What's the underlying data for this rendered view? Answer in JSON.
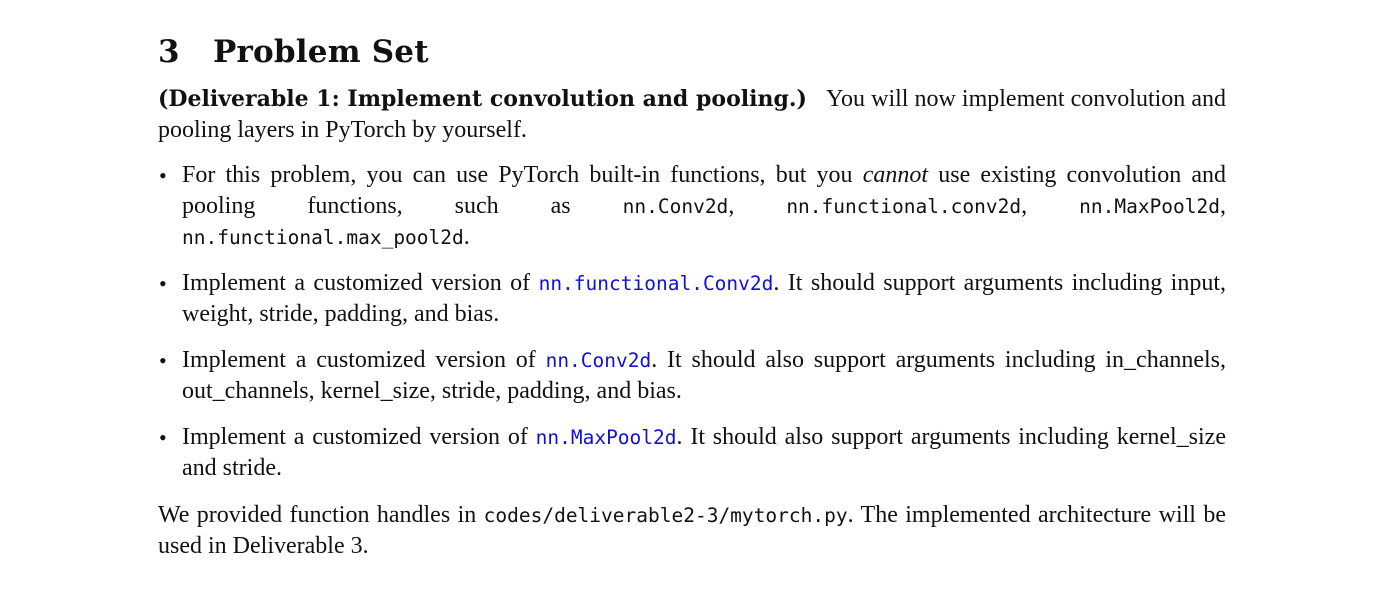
{
  "section": {
    "number": "3",
    "title": "Problem Set"
  },
  "intro": {
    "lead": "(Deliverable 1: Implement convolution and pooling.)",
    "text": "You will now implement convolution and pooling layers in PyTorch by yourself."
  },
  "items": [
    {
      "t1": "For this problem, you can use PyTorch built-in functions, but you ",
      "emph": "cannot",
      "t2": " use existing convolution and pooling functions, such as ",
      "code1": "nn.Conv2d",
      "sep1": ", ",
      "code2": "nn.functional.conv2d",
      "sep2": ", ",
      "code3": "nn.MaxPool2d",
      "sep3": ", ",
      "code4": "nn.functional.max_pool2d",
      "end": "."
    },
    {
      "t1": "Implement a customized version of ",
      "link": "nn.functional.Conv2d",
      "t2": ". It should support arguments including input, weight, stride, padding, and bias."
    },
    {
      "t1": "Implement a customized version of ",
      "link": "nn.Conv2d",
      "t2": ". It should also support arguments including in_channels, out_channels, kernel_size, stride, padding, and bias."
    },
    {
      "t1": "Implement a customized version of ",
      "link": "nn.MaxPool2d",
      "t2": ". It should also support arguments including kernel_size and stride."
    }
  ],
  "final": {
    "t1": "We provided function handles in ",
    "code": "codes/deliverable2-3/mytorch.py",
    "t2": ". The implemented architecture will be used in Deliverable 3."
  },
  "bullet_glyph": "•",
  "colors": {
    "text": "#111111",
    "link": "#1010d8",
    "background": "#ffffff"
  }
}
